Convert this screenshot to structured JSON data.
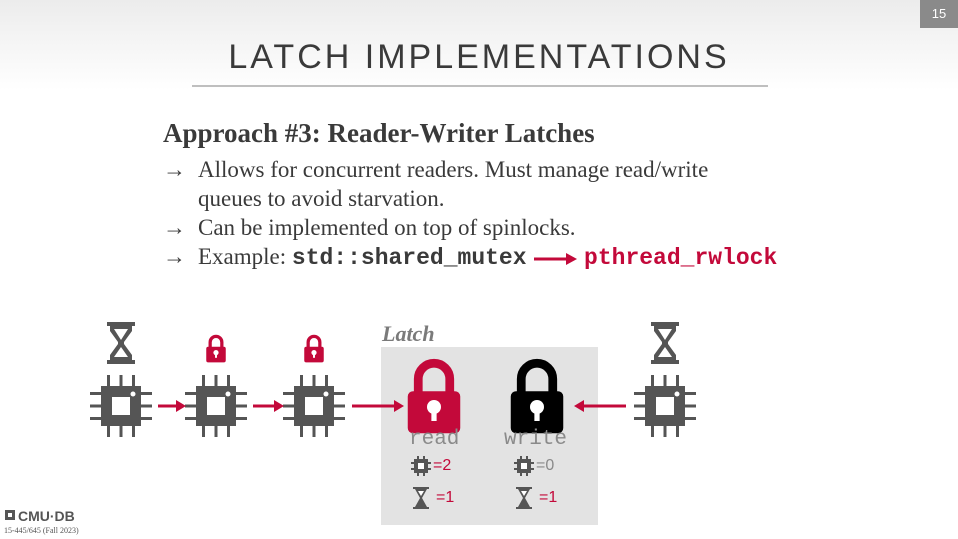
{
  "slide": {
    "page_number": "15",
    "title": "LATCH IMPLEMENTATIONS",
    "heading": "Approach #3: Reader-Writer Latches",
    "bullet_arrow": "→",
    "bullets": [
      "Allows for concurrent readers. Must manage read/write",
      "queues to avoid starvation.",
      "Can be implemented on top of spinlocks."
    ],
    "example_prefix": "Example:",
    "example_code_std": "std::shared_mutex",
    "example_code_pthread": "pthread_rwlock"
  },
  "diagram": {
    "latch_label": "Latch",
    "read_label": "read",
    "write_label": "write",
    "read_cpu_count": "=2",
    "read_wait_count": "=1",
    "write_cpu_count": "=0",
    "write_wait_count": "=1",
    "icons": [
      "hourglass-icon",
      "lock-icon",
      "cpu-icon"
    ]
  },
  "footer": {
    "logo": "CMU·DB",
    "course": "15-445/645 (Fall 2023)"
  },
  "colors": {
    "accent_red": "#c3093a",
    "dark_gray": "#555555",
    "text_gray": "#3a3a3a"
  }
}
